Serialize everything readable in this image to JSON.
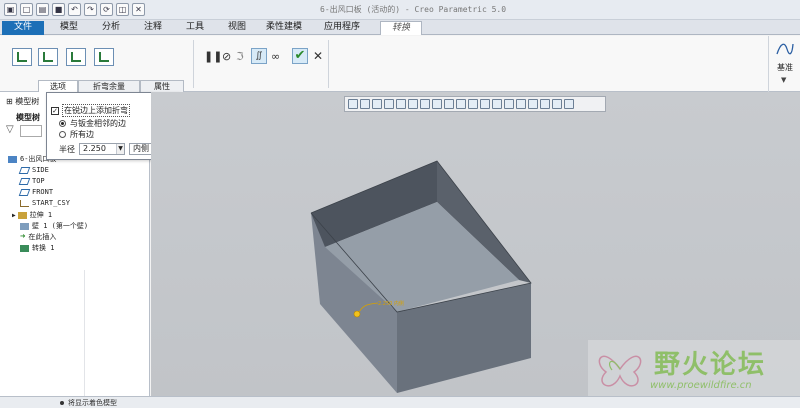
{
  "window": {
    "title": "6-出风口板 (活动的) - Creo Parametric 5.0"
  },
  "ribbon_tabs": [
    "文件",
    "模型",
    "分析",
    "注释",
    "工具",
    "视图",
    "柔性建模",
    "应用程序",
    "转换"
  ],
  "sub_tabs": [
    "选项",
    "折弯余量",
    "属性"
  ],
  "ribbon_right": {
    "label": "基准"
  },
  "tree": {
    "header": "模型树",
    "sub_header": "模型树",
    "items": [
      "6-出风口板",
      "SIDE",
      "TOP",
      "FRONT",
      "START_CSY",
      "拉伸 1",
      "壁 1 (第一个壁)",
      "在此插入",
      "转换 1"
    ]
  },
  "options_panel": {
    "checkbox_label": "在锐边上添加折弯",
    "checked": true,
    "radio_options": [
      "与钣金相邻的边",
      "所有边"
    ],
    "radio_selected": 0,
    "radius_label": "半径",
    "radius_value": "2.250",
    "side_value": "内侧"
  },
  "dimension": {
    "label": "2.250 内侧"
  },
  "watermark": {
    "title": "野火论坛",
    "url": "www.proewildfire.cn"
  },
  "status": {
    "message": "将显示着色模型"
  },
  "colors": {
    "file_tab": "#1c6fb7",
    "accent_green": "#2b8a2b",
    "watermark_green": "#8fbf69"
  }
}
